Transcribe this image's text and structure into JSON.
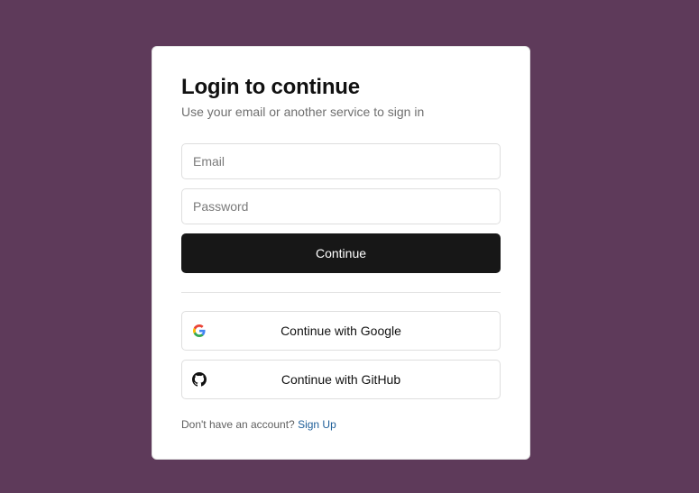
{
  "colors": {
    "page_background": "#5e3a5a",
    "card_background": "#ffffff",
    "primary_button": "#171717",
    "link": "#1f5f99"
  },
  "login": {
    "title": "Login to continue",
    "subtitle": "Use your email or another service to sign in",
    "email_placeholder": "Email",
    "email_value": "",
    "password_placeholder": "Password",
    "password_value": "",
    "continue_label": "Continue"
  },
  "oauth": {
    "google": {
      "label": "Continue with Google",
      "icon": "google-icon"
    },
    "github": {
      "label": "Continue with GitHub",
      "icon": "github-icon"
    }
  },
  "footer": {
    "prompt": "Don't have an account?",
    "signup_label": "Sign Up"
  }
}
